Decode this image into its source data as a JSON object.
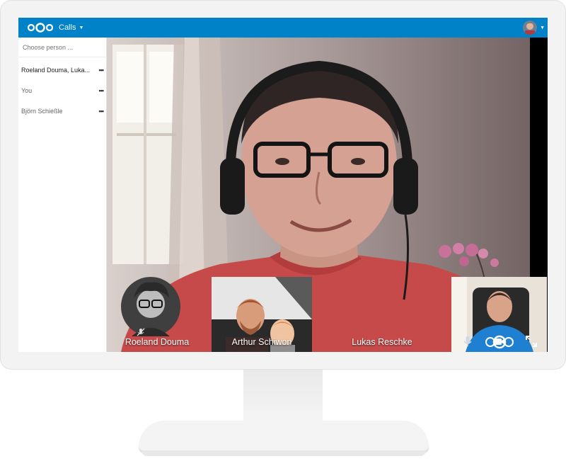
{
  "header": {
    "app_menu_label": "Calls",
    "brand_color": "#0082c9"
  },
  "sidebar": {
    "search_placeholder": "Choose person ...",
    "contacts": [
      {
        "name": "Roeland Douma, Luka...",
        "active": true
      },
      {
        "name": "You",
        "active": false
      },
      {
        "name": "Björn Schießle",
        "active": false
      }
    ],
    "more_label": "•••"
  },
  "call": {
    "participants": [
      {
        "name": "Roeland Douma",
        "video": false
      },
      {
        "name": "Arthur Schiwon",
        "video": true
      },
      {
        "name": "Lukas Reschke",
        "video": true
      }
    ]
  },
  "icons": {
    "logo": "nextcloud-logo",
    "mic": "microphone-icon",
    "camera": "video-camera-icon",
    "fullscreen": "fullscreen-icon",
    "muted": "muted-microphone-icon"
  }
}
